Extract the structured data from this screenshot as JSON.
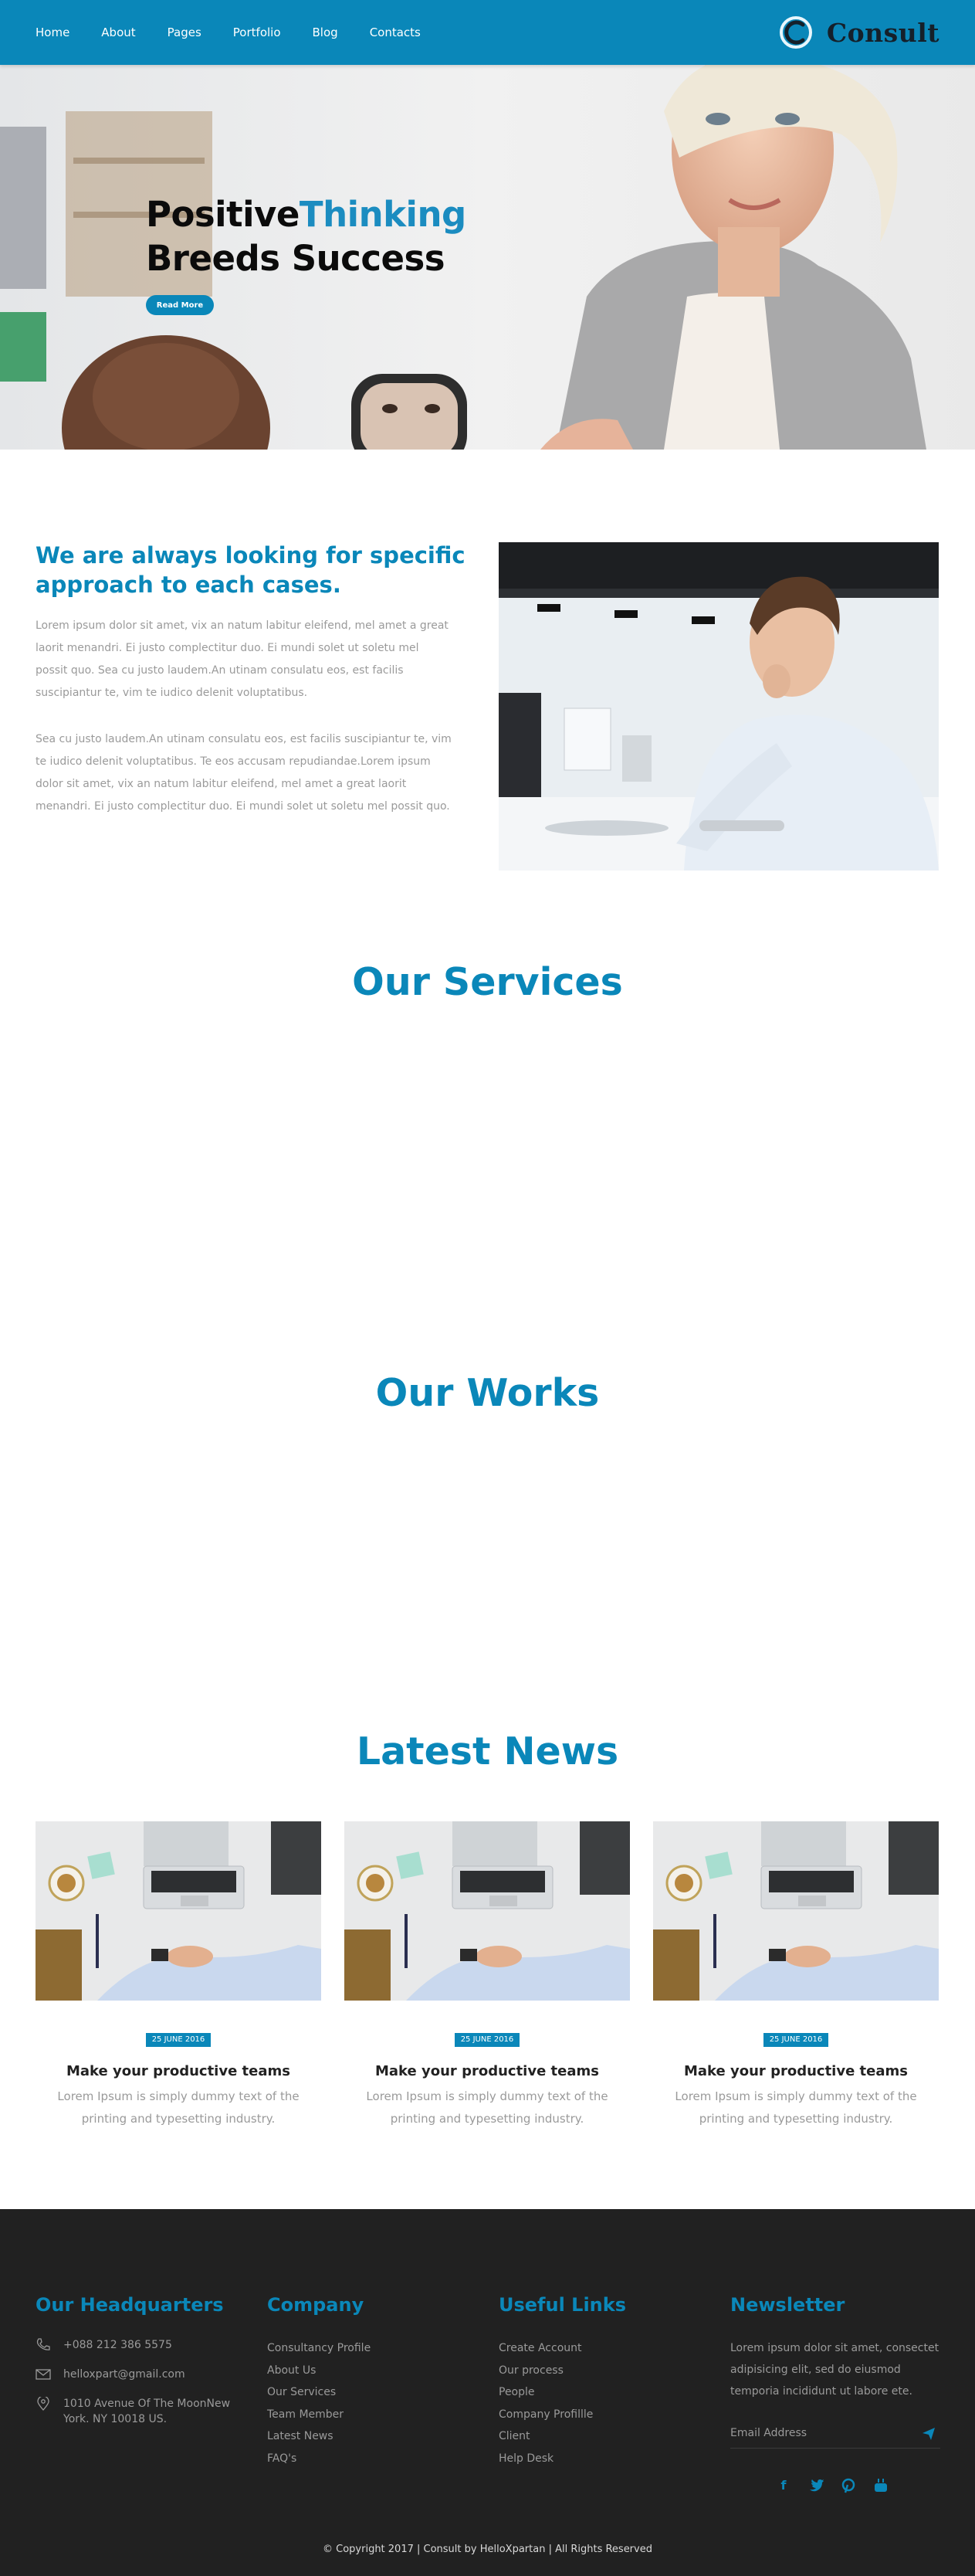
{
  "nav": {
    "items": [
      "Home",
      "About",
      "Pages",
      "Portfolio",
      "Blog",
      "Contacts"
    ],
    "brand": "Consult",
    "colors": {
      "primary": "#0a87b9",
      "brand_text": "#15202a"
    }
  },
  "hero": {
    "title_part1": "Positive",
    "title_accent": "Thinking",
    "title_line2": "Breeds Success",
    "button": "Read More"
  },
  "about": {
    "title": "We are always looking for specific approach to each cases.",
    "paragraph1": "Lorem ipsum dolor sit amet, vix an natum labitur eleifend, mel amet a great laorit menandri. Ei justo complectitur duo. Ei mundi solet ut soletu mel possit quo. Sea cu justo laudem.An utinam consulatu eos, est facilis suscipiantur te, vim te iudico delenit voluptatibus.",
    "paragraph2": "Sea cu justo laudem.An utinam consulatu eos, est facilis suscipiantur te, vim te iudico delenit voluptatibus. Te eos accusam repudiandae.Lorem ipsum dolor sit amet, vix an natum labitur eleifend, mel amet a great laorit menandri. Ei justo complectitur duo. Ei mundi solet ut soletu mel possit quo."
  },
  "sections": {
    "services": "Our Services",
    "works": "Our Works",
    "news": "Latest News"
  },
  "news": [
    {
      "date": "25 JUNE 2016",
      "title": "Make your productive teams",
      "text": "Lorem Ipsum is simply dummy text of the printing and typesetting industry."
    },
    {
      "date": "25 JUNE 2016",
      "title": "Make your productive teams",
      "text": "Lorem Ipsum is simply dummy text of the printing and typesetting industry."
    },
    {
      "date": "25 JUNE 2016",
      "title": "Make your productive teams",
      "text": "Lorem Ipsum is simply dummy text of the printing and typesetting industry."
    }
  ],
  "footer": {
    "hq": {
      "title": "Our Headquarters",
      "phone": "+088 212 386 5575",
      "email": "helloxpart@gmail.com",
      "address_line1": "1010 Avenue Of The MoonNew",
      "address_line2": "York. NY 10018 US."
    },
    "company": {
      "title": "Company",
      "links": [
        "Consultancy Profile",
        "About Us",
        "Our Services",
        "Team Member",
        "Latest News",
        "FAQ's"
      ]
    },
    "useful": {
      "title": "Useful Links",
      "links": [
        "Create Account",
        "Our process",
        "People",
        "Company Profillle",
        "Client",
        "Help Desk"
      ]
    },
    "newsletter": {
      "title": "Newsletter",
      "text": "Lorem ipsum dolor sit amet, consectet adipisicing elit, sed do eiusmod temporia incididunt ut labore ete.",
      "placeholder": "Email Address"
    },
    "socials": [
      "facebook-icon",
      "twitter-icon",
      "pinterest-icon",
      "youtube-icon"
    ],
    "copyright": "© Copyright 2017 | Consult by HelloXpartan | All Rights Reserved"
  }
}
